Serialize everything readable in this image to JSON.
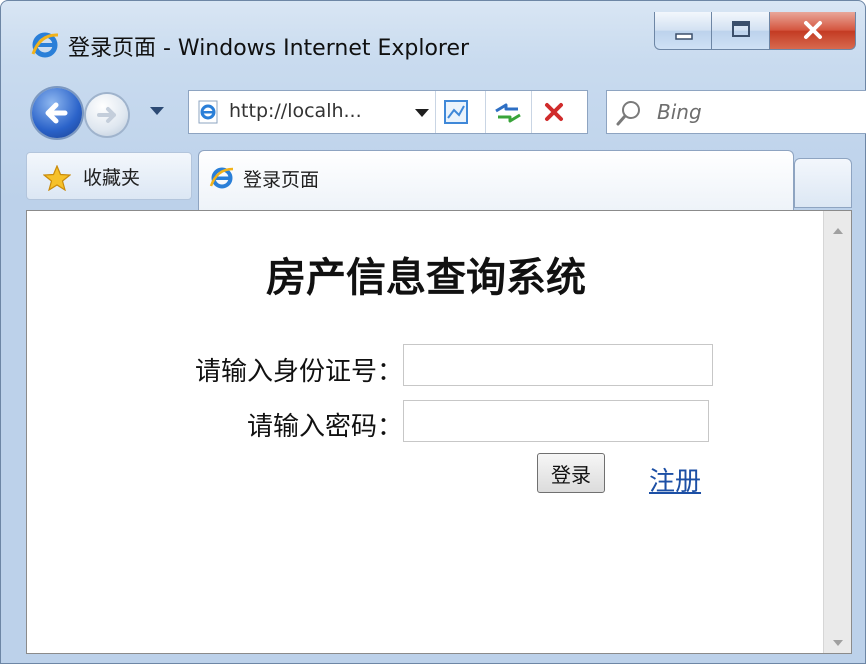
{
  "window": {
    "title": "登录页面 - Windows Internet Explorer"
  },
  "nav": {
    "address": "http://localh...",
    "search_placeholder": "Bing"
  },
  "favorites": {
    "label": "收藏夹"
  },
  "tab": {
    "label": "登录页面"
  },
  "page": {
    "title": "房产信息查询系统",
    "id_label": "请输入身份证号：",
    "id_value": "",
    "password_label": "请输入密码：",
    "password_value": "",
    "login_button": "登录",
    "register_link": "注册"
  },
  "icons": {
    "ie": "ie-logo-icon",
    "back": "back-arrow-icon",
    "forward": "forward-arrow-icon",
    "compat": "compatibility-view-icon",
    "refresh": "refresh-icon",
    "stop": "stop-icon",
    "search": "search-icon",
    "star": "favorites-star-icon"
  },
  "colors": {
    "link": "#1c4fa5",
    "close_button": "#c33a22",
    "frame": "#bcd1ea"
  }
}
